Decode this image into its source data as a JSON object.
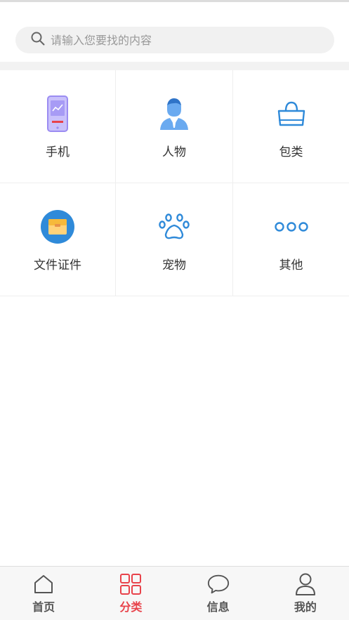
{
  "search": {
    "placeholder": "请输入您要找的内容"
  },
  "categories": [
    {
      "label": "手机",
      "icon": "phone-icon"
    },
    {
      "label": "人物",
      "icon": "person-icon"
    },
    {
      "label": "包类",
      "icon": "bag-icon"
    },
    {
      "label": "文件证件",
      "icon": "folder-icon"
    },
    {
      "label": "宠物",
      "icon": "paw-icon"
    },
    {
      "label": "其他",
      "icon": "more-icon"
    }
  ],
  "tabbar": {
    "items": [
      {
        "label": "首页",
        "icon": "home-icon"
      },
      {
        "label": "分类",
        "icon": "grid-icon"
      },
      {
        "label": "信息",
        "icon": "chat-icon"
      },
      {
        "label": "我的",
        "icon": "user-icon"
      }
    ],
    "active_index": 1
  },
  "colors": {
    "accent": "#e8424a",
    "icon_blue": "#2f8ad9",
    "phone_purple": "#9b8cf2",
    "folder_yellow": "#f6b93b"
  }
}
